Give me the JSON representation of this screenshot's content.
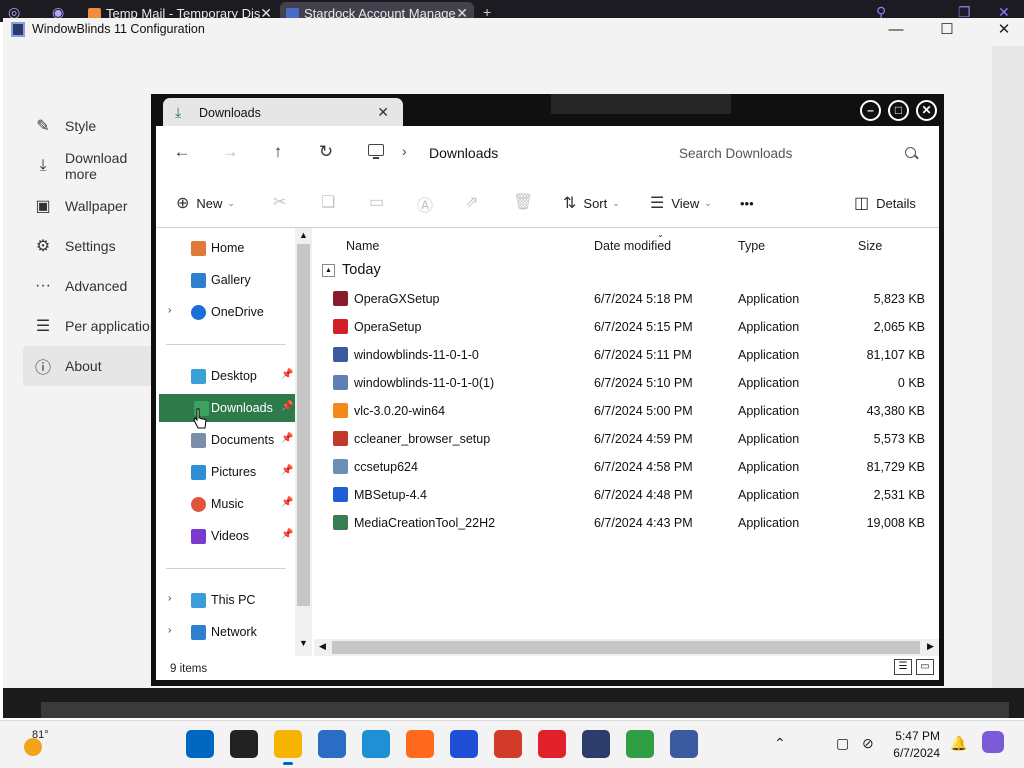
{
  "browser": {
    "tabs": [
      {
        "label": "Temp Mail - Temporary Dis"
      },
      {
        "label": "Stardock Account Manage"
      }
    ],
    "new_tab": "+"
  },
  "config_window": {
    "title": "WindowBlinds 11 Configuration",
    "controls": {
      "minimize": "—",
      "maximize": "☐",
      "close": "✕"
    },
    "nav": [
      {
        "label": "Style",
        "icon": "brush-icon"
      },
      {
        "label": "Download more",
        "icon": "download-icon"
      },
      {
        "label": "Wallpaper",
        "icon": "image-icon"
      },
      {
        "label": "Settings",
        "icon": "gear-icon"
      },
      {
        "label": "Advanced",
        "icon": "more-icon"
      },
      {
        "label": "Per application",
        "icon": "list-icon"
      },
      {
        "label": "About",
        "icon": "info-icon"
      }
    ],
    "nav_selected": "About"
  },
  "explorer": {
    "tab_label": "Downloads",
    "tab_close": "✕",
    "address": {
      "separator": "›",
      "crumb": "Downloads"
    },
    "search_placeholder": "Search Downloads",
    "commands": {
      "new": "New",
      "sort": "Sort",
      "view": "View",
      "more": "•••",
      "details": "Details"
    },
    "nav": {
      "home": "Home",
      "gallery": "Gallery",
      "onedrive": "OneDrive",
      "desktop": "Desktop",
      "downloads": "Downloads",
      "documents": "Documents",
      "pictures": "Pictures",
      "music": "Music",
      "videos": "Videos",
      "this_pc": "This PC",
      "network": "Network",
      "selected": "Downloads"
    },
    "columns": {
      "name": "Name",
      "date": "Date modified",
      "type": "Type",
      "size": "Size"
    },
    "group": "Today",
    "files": [
      {
        "name": "OperaGXSetup",
        "date": "6/7/2024 5:18 PM",
        "type": "Application",
        "size": "5,823 KB",
        "color": "#8a1b2a"
      },
      {
        "name": "OperaSetup",
        "date": "6/7/2024 5:15 PM",
        "type": "Application",
        "size": "2,065 KB",
        "color": "#d21f27"
      },
      {
        "name": "windowblinds-11-0-1-0",
        "date": "6/7/2024 5:11 PM",
        "type": "Application",
        "size": "81,107 KB",
        "color": "#3d5a9e"
      },
      {
        "name": "windowblinds-11-0-1-0(1)",
        "date": "6/7/2024 5:10 PM",
        "type": "Application",
        "size": "0 KB",
        "color": "#5f7fb5"
      },
      {
        "name": "vlc-3.0.20-win64",
        "date": "6/7/2024 5:00 PM",
        "type": "Application",
        "size": "43,380 KB",
        "color": "#f28a1a"
      },
      {
        "name": "ccleaner_browser_setup",
        "date": "6/7/2024 4:59 PM",
        "type": "Application",
        "size": "5,573 KB",
        "color": "#c0392b"
      },
      {
        "name": "ccsetup624",
        "date": "6/7/2024 4:58 PM",
        "type": "Application",
        "size": "81,729 KB",
        "color": "#6c8fb8"
      },
      {
        "name": "MBSetup-4.4",
        "date": "6/7/2024 4:48 PM",
        "type": "Application",
        "size": "2,531 KB",
        "color": "#1f5fd6"
      },
      {
        "name": "MediaCreationTool_22H2",
        "date": "6/7/2024 4:43 PM",
        "type": "Application",
        "size": "19,008 KB",
        "color": "#3a7d55"
      }
    ],
    "status": "9 items"
  },
  "taskbar": {
    "weather_temp": "81°",
    "clock_time": "5:47 PM",
    "clock_date": "6/7/2024",
    "apps": [
      {
        "name": "start-button",
        "color": "#0067c0"
      },
      {
        "name": "search-button",
        "color": "#222222"
      },
      {
        "name": "file-explorer-app",
        "color": "#f5b400"
      },
      {
        "name": "microsoft-store-app",
        "color": "#2b6cc4"
      },
      {
        "name": "edge-app",
        "color": "#1f8fd6"
      },
      {
        "name": "firefox-app",
        "color": "#ff6a1f"
      },
      {
        "name": "malwarebytes-app",
        "color": "#1f4fd6"
      },
      {
        "name": "ccleaner-app",
        "color": "#d23a2a"
      },
      {
        "name": "opera-app",
        "color": "#e0202a"
      },
      {
        "name": "stardock-app",
        "color": "#2c3d6b"
      },
      {
        "name": "chrome-app",
        "color": "#2ea043"
      },
      {
        "name": "windowblinds-app",
        "color": "#3b5aa0"
      }
    ],
    "tray": {
      "chevron": "⌃"
    }
  }
}
